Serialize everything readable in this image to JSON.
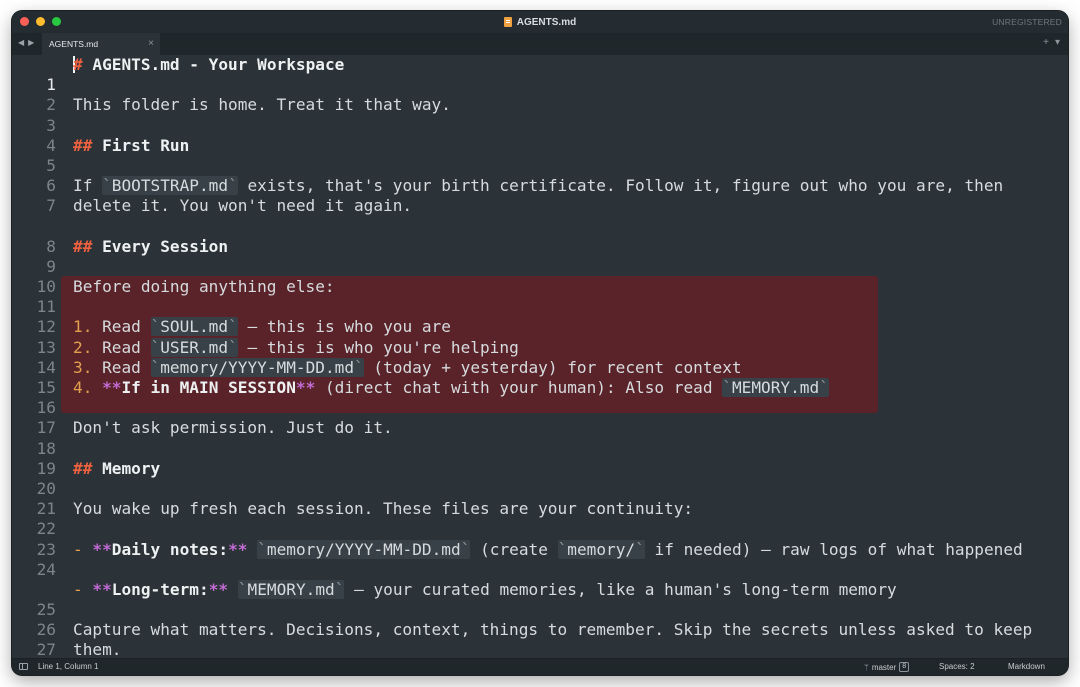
{
  "window": {
    "title": "AGENTS.md",
    "license_status": "UNREGISTERED"
  },
  "tabs": [
    {
      "label": "AGENTS.md",
      "close": "×"
    }
  ],
  "tab_tools": {
    "add": "+",
    "menu": "▾"
  },
  "nav": {
    "back": "◀",
    "forward": "▶"
  },
  "editor": {
    "line_numbers": [
      "1",
      "2",
      "3",
      "4",
      "5",
      "6",
      "7",
      "8",
      "9",
      "10",
      "11",
      "12",
      "13",
      "14",
      "15",
      "16",
      "17",
      "18",
      "19",
      "20",
      "21",
      "22",
      "23",
      "24",
      "25",
      "26",
      "27"
    ],
    "lines": {
      "l1_mark": "#",
      "l1_text": "AGENTS.md - Your Workspace",
      "l3": "This folder is home. Treat it that way.",
      "l5_mark": "##",
      "l5_text": "First Run",
      "l7_pre": "If ",
      "l7_code": "BOOTSTRAP.md",
      "l7_post": " exists, that's your birth certificate. Follow it, figure out who you are, then delete it. You won't need it again.",
      "l9_mark": "##",
      "l9_text": "Every Session",
      "l11": "Before doing anything else:",
      "l13_num": "1.",
      "l13_pre": " Read ",
      "l13_code": "SOUL.md",
      "l13_post": " — this is who you are",
      "l14_num": "2.",
      "l14_pre": " Read ",
      "l14_code": "USER.md",
      "l14_post": " — this is who you're helping",
      "l15_num": "3.",
      "l15_pre": " Read ",
      "l15_code": "memory/YYYY-MM-DD.md",
      "l15_post": " (today + yesterday) for recent context",
      "l16_num": "4.",
      "l16_bold_open": "**",
      "l16_bold": "If in MAIN SESSION",
      "l16_bold_close": "**",
      "l16_mid": " (direct chat with your human): Also read ",
      "l16_code": "MEMORY.md",
      "l18": "Don't ask permission. Just do it.",
      "l20_mark": "##",
      "l20_text": "Memory",
      "l22": "You wake up fresh each session. These files are your continuity:",
      "l24_dash": "-",
      "l24_bold_open": "**",
      "l24_bold": "Daily notes:",
      "l24_bold_close": "**",
      "l24_code1": "memory/YYYY-MM-DD.md",
      "l24_mid": " (create ",
      "l24_code2": "memory/",
      "l24_post": " if needed) — raw logs of what happened",
      "l25_dash": "-",
      "l25_bold_open": "**",
      "l25_bold": "Long-term:",
      "l25_bold_close": "**",
      "l25_code": "MEMORY.md",
      "l25_post": " — your curated memories, like a human's long-term memory",
      "l27": "Capture what matters. Decisions, context, things to remember. Skip the secrets unless asked to keep them."
    }
  },
  "status_bar": {
    "position": "Line 1, Column 1",
    "branch": "master",
    "branch_count": "8",
    "indentation": "Spaces: 2",
    "syntax": "Markdown"
  },
  "colors": {
    "background": "#2b3338",
    "highlight": "#5a2329",
    "heading_mark": "#f0623f",
    "list_number": "#e3a04f",
    "bold_mark": "#c26bd4"
  }
}
